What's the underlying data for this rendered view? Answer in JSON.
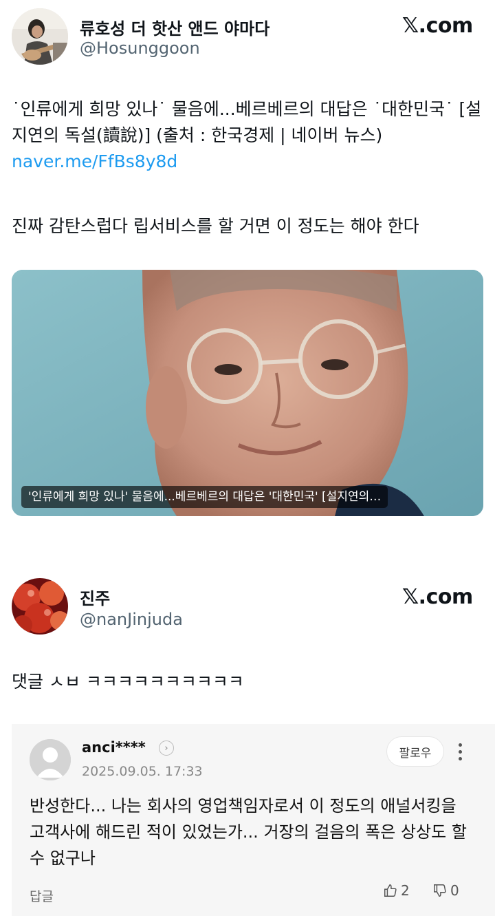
{
  "tweet1": {
    "display_name": "류호성 더 핫산 앤드 야마다",
    "handle": "@Hosunggoon",
    "site_logo": "𝕏.com",
    "text_prefix": "˙인류에게 희망 있나˙ 물음에...베르베르의 대답은 ˙대한민국˙ [설지연의 독설(讀說)] (출처 : 한국경제 | 네이버 뉴스) ",
    "link": "naver.me/FfBs8y8d",
    "text2": "진짜 감탄스럽다 립서비스를 할 거면 이 정도는 해야 한다",
    "media_caption": "'인류에게 희망 있나' 물음에...베르베르의 대답은 '대한민국' [설지연의…"
  },
  "tweet2": {
    "display_name": "진주",
    "handle": "@nanJinjuda",
    "site_logo": "𝕏.com",
    "text": "댓글 ㅅㅂ ㅋㅋㅋㅋㅋㅋㅋㅋㅋㅋ"
  },
  "comment": {
    "username": "anci****",
    "date": "2025.09.05. 17:33",
    "follow_label": "팔로우",
    "text": "반성한다... 나는 회사의 영업책임자로서 이 정도의 애널서킹을 고객사에 해드린 적이 있었는가... 거장의 걸음의 폭은 상상도 할 수 없구나",
    "reply_label": "답글",
    "likes": "2",
    "dislikes": "0"
  },
  "colors": {
    "link": "#1d9bf0",
    "handle": "#536471",
    "card_bg": "#f6f6f6"
  },
  "icons": [
    "avatar-photo",
    "x-logo",
    "chevron-right-icon",
    "kebab-menu-icon",
    "thumbs-up-icon",
    "thumbs-down-icon"
  ]
}
